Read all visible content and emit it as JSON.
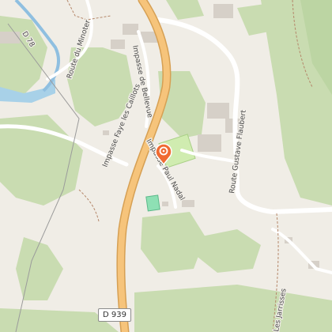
{
  "map": {
    "colors": {
      "background": "#f0ede6",
      "wood": "#c9dcb1",
      "wood_dark": "#bcd5a3",
      "water": "#a8d1e8",
      "river": "#8fbfe0",
      "main_road": "#f6c47b",
      "main_road_casing": "#d6a054",
      "minor_road": "#ffffff",
      "building": "#d6d0c8",
      "park": "#d0ecb0",
      "pool": "#8ee0b4",
      "marker": "#f06b32"
    },
    "road_labels": {
      "d78": "D 78",
      "route_minoter": "Route du Minoter",
      "impasse_bellevue": "Impasse de Bellevue",
      "impasse_faye": "Impasse Faye les Caillots",
      "impasse_nadal": "Impasse Paul Nadal",
      "route_flaubert": "Route Gustave Flaubert",
      "jarrisses": "Les Jarrisses"
    },
    "shield": "D 939",
    "marker_icon": "map-pin-icon"
  }
}
